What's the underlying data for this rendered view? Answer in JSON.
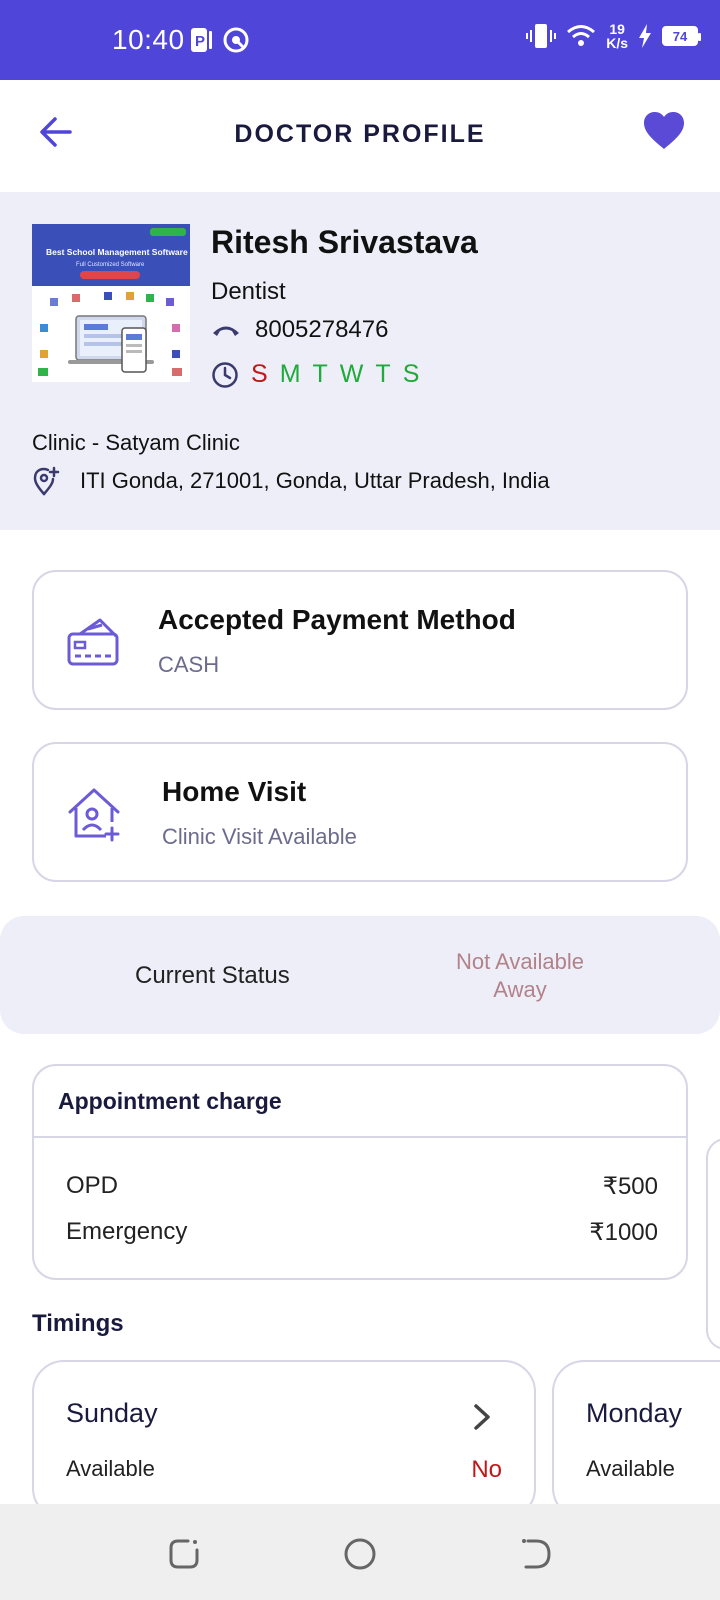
{
  "status_bar": {
    "time": "10:40",
    "net_speed_value": "19",
    "net_speed_unit": "K/s",
    "battery": "74"
  },
  "app_bar": {
    "title": "DOCTOR PROFILE"
  },
  "profile": {
    "image_banner": "Best School Management Software",
    "image_sub": "Full Customized Software",
    "name": "Ritesh Srivastava",
    "specialty": "Dentist",
    "phone": "8005278476",
    "days": [
      {
        "letter": "S",
        "color": "#c01818"
      },
      {
        "letter": "M",
        "color": "#1faa3a"
      },
      {
        "letter": "T",
        "color": "#1faa3a"
      },
      {
        "letter": "W",
        "color": "#1faa3a"
      },
      {
        "letter": "T",
        "color": "#1faa3a"
      },
      {
        "letter": "S",
        "color": "#1faa3a"
      }
    ],
    "clinic": "Clinic - Satyam Clinic",
    "address": "ITI Gonda, 271001, Gonda, Uttar Pradesh, India"
  },
  "payment": {
    "title": "Accepted Payment Method",
    "value": "CASH"
  },
  "home_visit": {
    "title": "Home Visit",
    "value": "Clinic Visit Available"
  },
  "current_status": {
    "label": "Current Status",
    "value_line1": "Not Available",
    "value_line2": "Away"
  },
  "charges": {
    "title": "Appointment charge",
    "rows": [
      {
        "label": "OPD",
        "amount": "₹500"
      },
      {
        "label": "Emergency",
        "amount": "₹1000"
      }
    ]
  },
  "timings": {
    "title": "Timings",
    "cards": [
      {
        "day": "Sunday",
        "avail_label": "Available",
        "avail_value": "No"
      },
      {
        "day": "Monday",
        "avail_label": "Available",
        "avail_value": ""
      }
    ]
  },
  "colors": {
    "accent": "#4f46d9",
    "icon_purple": "#6c5bd6",
    "status_red": "#c01818",
    "status_green": "#1faa3a"
  }
}
